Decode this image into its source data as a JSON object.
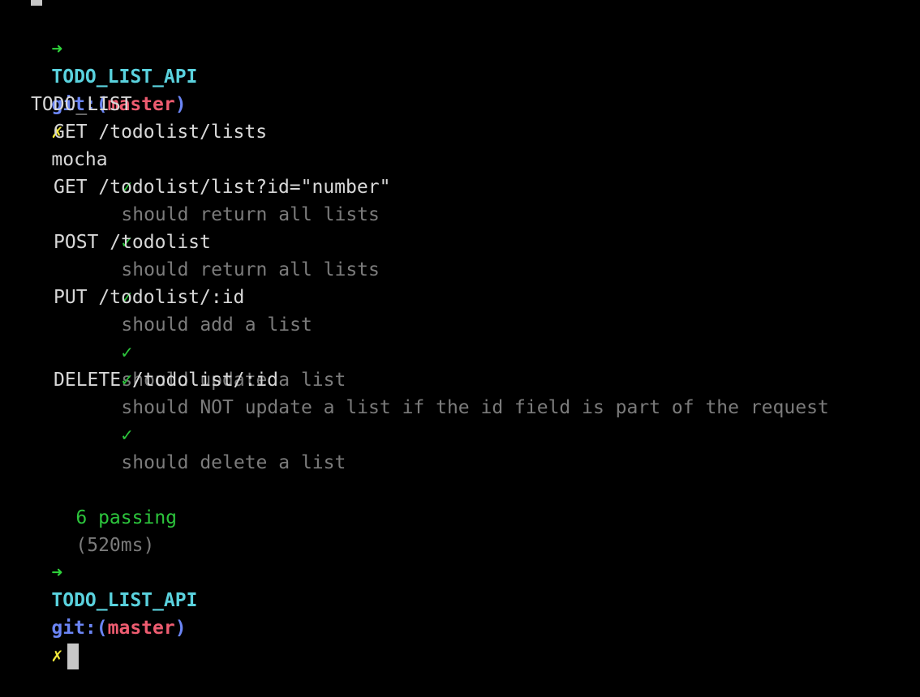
{
  "prompt": {
    "arrow": "➜",
    "dir": "TODO_LIST_API",
    "git_label_open": "git:(",
    "branch": "master",
    "git_label_close": ")",
    "dirty_mark": "✗",
    "command": "mocha"
  },
  "suite": {
    "name": "TODO_LIST",
    "groups": [
      {
        "title": "GET /todolist/lists",
        "tests": [
          "should return all lists"
        ]
      },
      {
        "title": "GET /todolist/list?id=\"number\"",
        "tests": [
          "should return all lists"
        ]
      },
      {
        "title": "POST /todolist",
        "tests": [
          "should add a list"
        ]
      },
      {
        "title": "PUT /todolist/:id",
        "tests": [
          "should update a list",
          "should NOT update a list if the id field is part of the request"
        ]
      },
      {
        "title": "DELETE /todolist/:id",
        "tests": [
          "should delete a list"
        ]
      }
    ]
  },
  "check_mark": "✓",
  "summary": {
    "passing": "6 passing",
    "duration": "(520ms)"
  },
  "colors": {
    "background": "#000000",
    "arrow": "#2fd33c",
    "dir": "#5ad2de",
    "git": "#6b85f5",
    "branch": "#ee5c70",
    "dirty": "#f1e63b",
    "pass": "#2cc43c",
    "dim": "#7b7b7b"
  }
}
